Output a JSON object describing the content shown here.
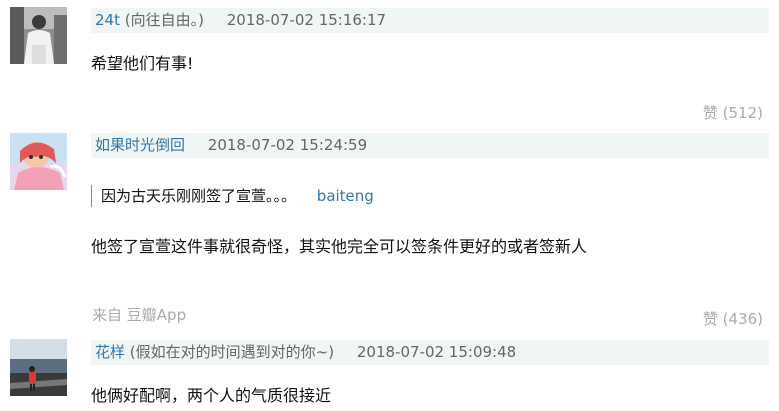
{
  "comments": [
    {
      "author": "24t",
      "author_note": "(向往自由。)",
      "time": "2018-07-02 15:16:17",
      "content": "希望他们有事!",
      "vote_label": "赞",
      "vote_count": "(512)"
    },
    {
      "author": "如果时光倒回",
      "author_note": "",
      "time": "2018-07-02 15:24:59",
      "quote_text": "因为古天乐刚刚签了宣萱。。。",
      "quote_author": "baiteng",
      "content": "他签了宣萱这件事就很奇怪，其实他完全可以签条件更好的或者签新人",
      "source_prefix": "来自",
      "source_app": "豆瓣App",
      "vote_label": "赞",
      "vote_count": "(436)"
    },
    {
      "author": "花样",
      "author_note": "(假如在对的时间遇到对的你~)",
      "time": "2018-07-02 15:09:48",
      "content": "他俩好配啊，两个人的气质很接近"
    }
  ],
  "icons": {
    "avatar_1": "person-photo-avatar",
    "avatar_2": "anime-illustration-avatar",
    "avatar_3": "street-photo-avatar"
  },
  "colors": {
    "link": "#3377aa",
    "meta_bg": "#f0f6f3",
    "muted": "#aaaaaa"
  }
}
